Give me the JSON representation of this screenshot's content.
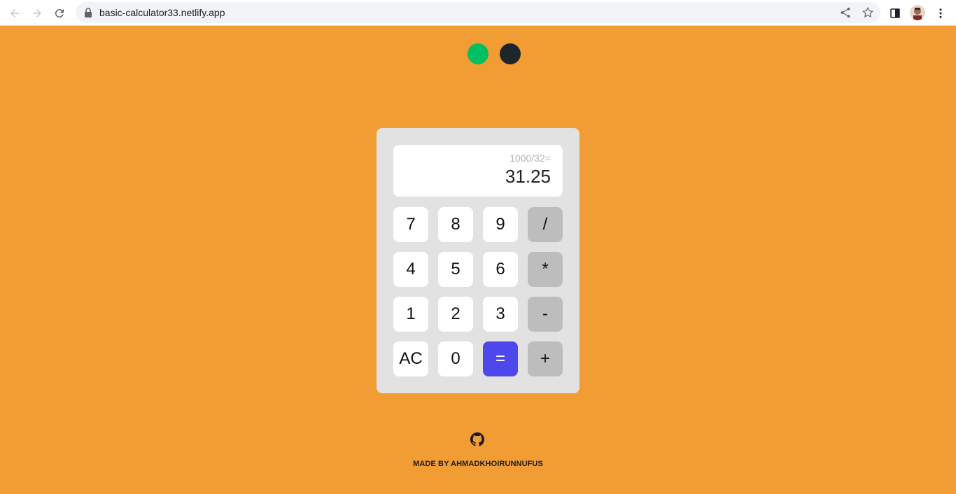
{
  "browser": {
    "url": "basic-calculator33.netlify.app"
  },
  "theme": {
    "background": "#f29d33",
    "dots": [
      "#00bf63",
      "#1e252b"
    ],
    "accent": "#4e48ec"
  },
  "display": {
    "expression": "1000/32=",
    "result": "31.25"
  },
  "keys": {
    "k7": "7",
    "k8": "8",
    "k9": "9",
    "div": "/",
    "k4": "4",
    "k5": "5",
    "k6": "6",
    "mul": "*",
    "k1": "1",
    "k2": "2",
    "k3": "3",
    "sub": "-",
    "ac": "AC",
    "k0": "0",
    "eq": "=",
    "add": "+"
  },
  "footer": {
    "credit": "MADE BY AHMADKHOIRUNNUFUS",
    "icon": "github-icon"
  }
}
